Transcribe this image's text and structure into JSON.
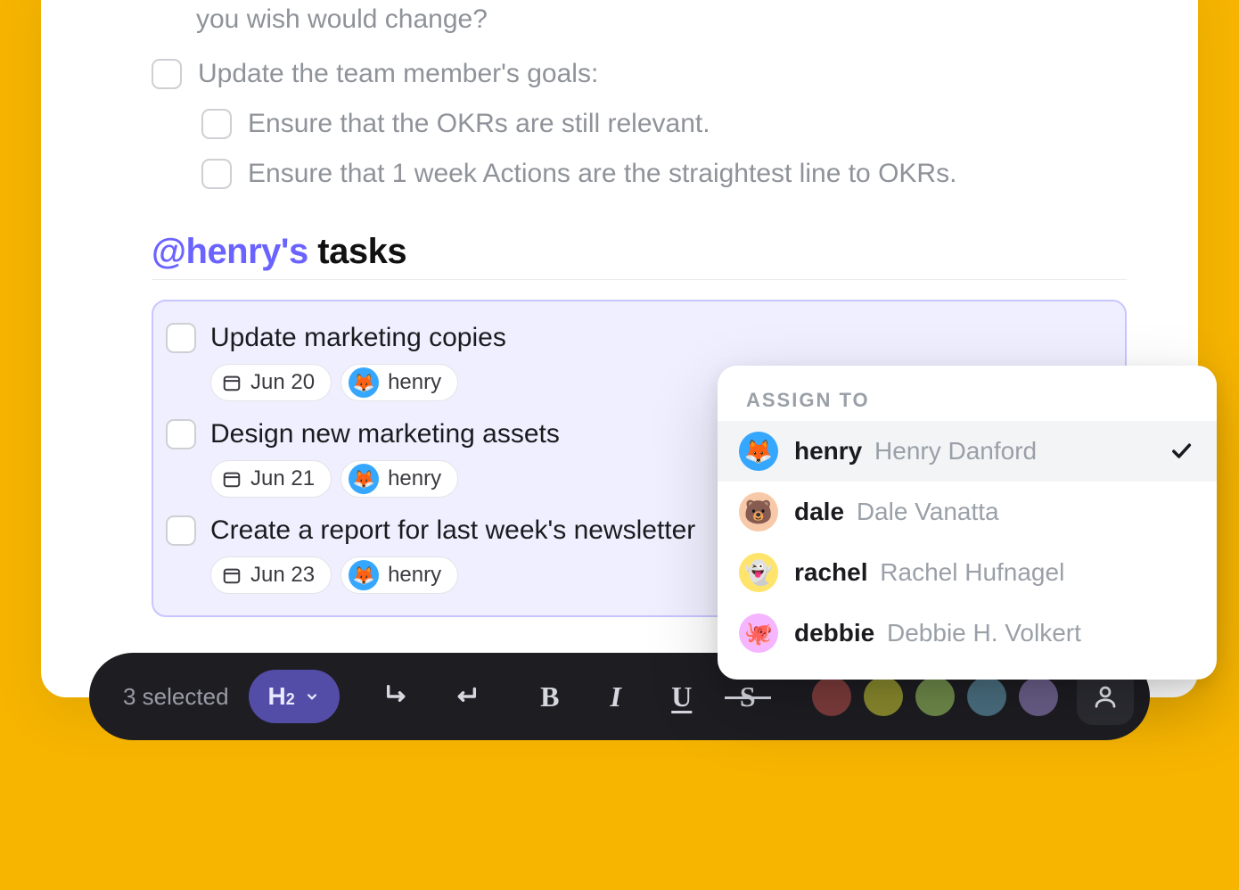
{
  "doc": {
    "prev_fragment": "you wish would change?",
    "items": [
      {
        "text": "Update the team member's goals:"
      },
      {
        "text": "Ensure that the OKRs are still relevant.",
        "indent": true
      },
      {
        "text": "Ensure that 1 week Actions are the straightest line to OKRs.",
        "indent": true
      }
    ],
    "section": {
      "mention": "@henry's",
      "rest": " tasks"
    },
    "tasks": [
      {
        "title": "Update marketing copies",
        "date": "Jun 20",
        "assignee": "henry",
        "avatar": "fox"
      },
      {
        "title": "Design new marketing assets",
        "date": "Jun 21",
        "assignee": "henry",
        "avatar": "fox"
      },
      {
        "title": "Create a report for last week's newsletter",
        "date": "Jun 23",
        "assignee": "henry",
        "avatar": "fox"
      }
    ]
  },
  "popover": {
    "title": "ASSIGN TO",
    "people": [
      {
        "username": "henry",
        "full": "Henry Danford",
        "avatar": "fox",
        "selected": true
      },
      {
        "username": "dale",
        "full": "Dale Vanatta",
        "avatar": "bear",
        "selected": false
      },
      {
        "username": "rachel",
        "full": "Rachel Hufnagel",
        "avatar": "ghost",
        "selected": false
      },
      {
        "username": "debbie",
        "full": "Debbie H. Volkert",
        "avatar": "octopus",
        "selected": false
      }
    ]
  },
  "toolbar": {
    "count_label": "3 selected",
    "heading_label": "H",
    "heading_sub": "2",
    "buttons": {
      "bold": "B",
      "italic": "I",
      "underline": "U",
      "strike": "S"
    },
    "colors": [
      "#7d3c3c",
      "#8a8a2e",
      "#6f8a4a",
      "#4a6f80",
      "#6a5f8a"
    ]
  }
}
